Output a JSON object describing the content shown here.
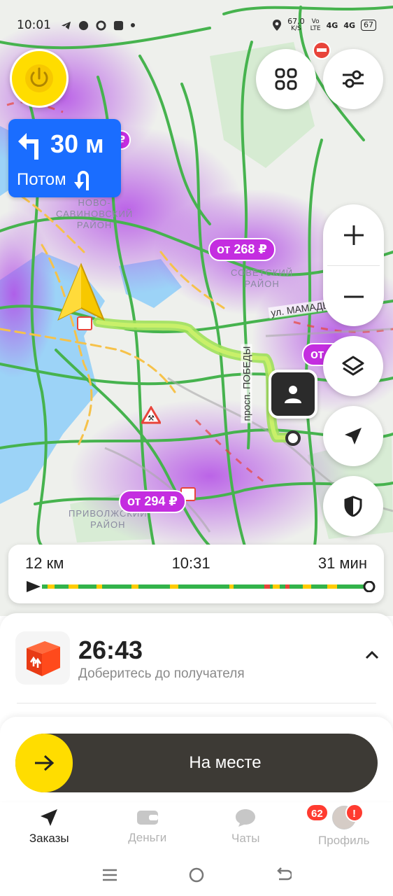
{
  "status_bar": {
    "time": "10:01",
    "net_speed_value": "67,0",
    "net_speed_unit": "K/S",
    "volte_top": "Vo",
    "volte_bottom": "LTE",
    "signal1": "4G",
    "signal2": "4G",
    "battery": "67"
  },
  "maneuver": {
    "distance": "30 м",
    "next_label": "Потом"
  },
  "map": {
    "districts": [
      "НОВО-",
      "САВИНОВСКИЙ",
      "РАЙОН",
      "СОВЕТСКИЙ",
      "РАЙОН",
      "ПРИВОЛЖСКИЙ",
      "РАЙОН"
    ],
    "streets": [
      "ул. МАМАДЫШ",
      "просп. ПОБЕДЫ"
    ],
    "prices": [
      "от 268 ₽",
      "от 294 ₽",
      "от",
      "₽"
    ]
  },
  "route": {
    "distance": "12 км",
    "arrival": "10:31",
    "duration": "31 мин"
  },
  "order": {
    "timer": "26:43",
    "subtitle": "Доберитесь до получателя"
  },
  "action": {
    "label": "На месте"
  },
  "tabs": [
    {
      "label": "Заказы"
    },
    {
      "label": "Деньги"
    },
    {
      "label": "Чаты",
      "badge": "62"
    },
    {
      "label": "Профиль",
      "badge": "!"
    }
  ],
  "colors": {
    "accent_yellow": "#ffdd00",
    "maneuver_blue": "#1a6dff",
    "price_purple": "#c42de0",
    "slider_dark": "#3d3a35",
    "traffic_green": "#33b34a",
    "traffic_yellow": "#ffcc00",
    "traffic_red": "#e8443a"
  }
}
